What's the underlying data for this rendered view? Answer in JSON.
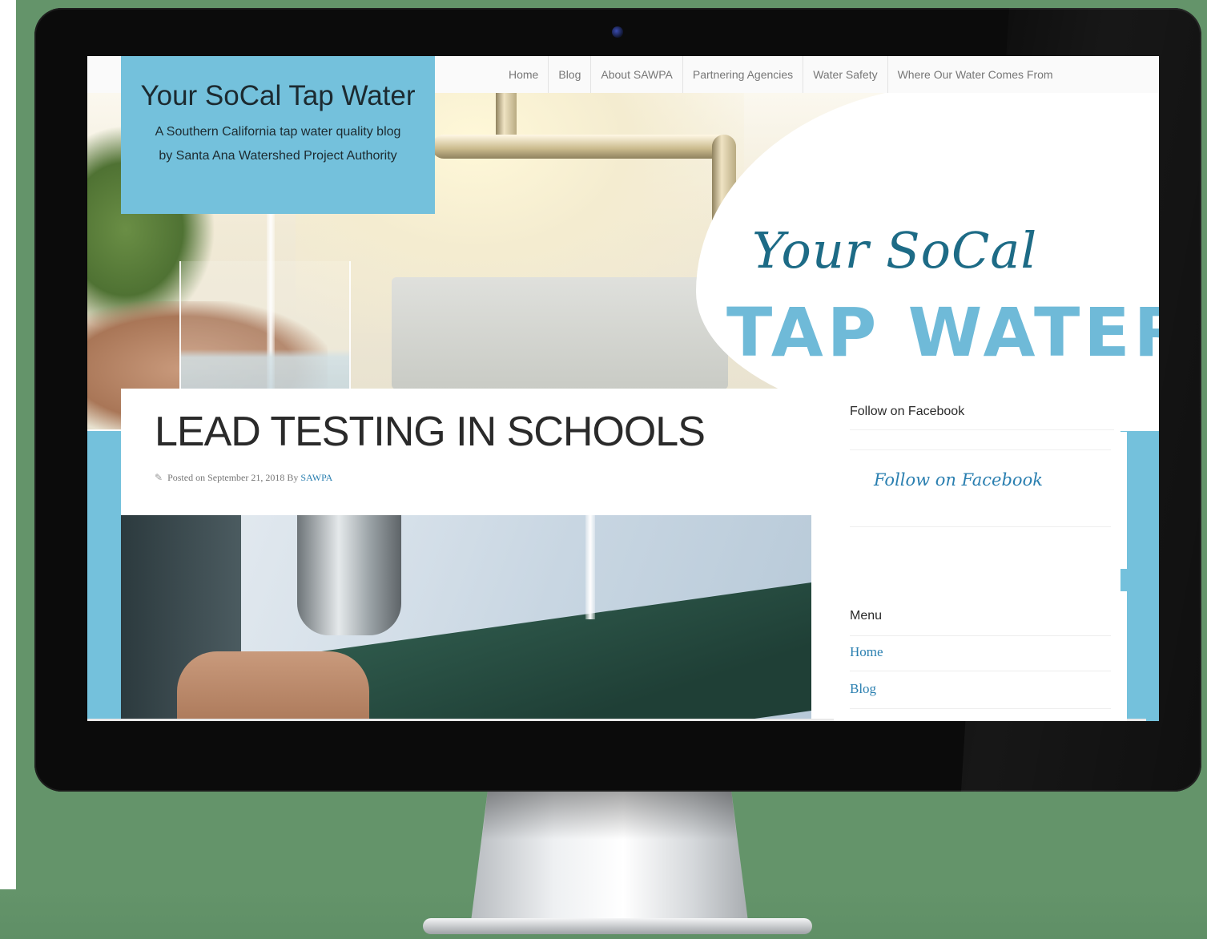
{
  "nav": {
    "items": [
      {
        "label": "Home"
      },
      {
        "label": "Blog"
      },
      {
        "label": "About SAWPA"
      },
      {
        "label": "Partnering Agencies"
      },
      {
        "label": "Water Safety"
      },
      {
        "label": "Where Our Water Comes From"
      }
    ]
  },
  "site": {
    "title": "Your SoCal Tap Water",
    "tagline": "A Southern California tap water quality blog by Santa Ana Watershed Project Authority"
  },
  "hero_logo": {
    "script_text": "Your SoCal",
    "big_text": "TAP WATER"
  },
  "article": {
    "title": "LEAD TESTING IN SCHOOLS",
    "meta_prefix": "Posted on September 21, 2018 By ",
    "author": "SAWPA"
  },
  "sidebar": {
    "facebook_widget": {
      "title": "Follow on Facebook",
      "link_label": "Follow on Facebook"
    },
    "menu_widget": {
      "title": "Menu",
      "links": [
        {
          "label": "Home"
        },
        {
          "label": "Blog"
        }
      ]
    }
  },
  "colors": {
    "accent_blue": "#74c1dc",
    "link_blue": "#2a7fb0",
    "logo_dark": "#1d6b86",
    "backdrop_green": "#64946a"
  }
}
